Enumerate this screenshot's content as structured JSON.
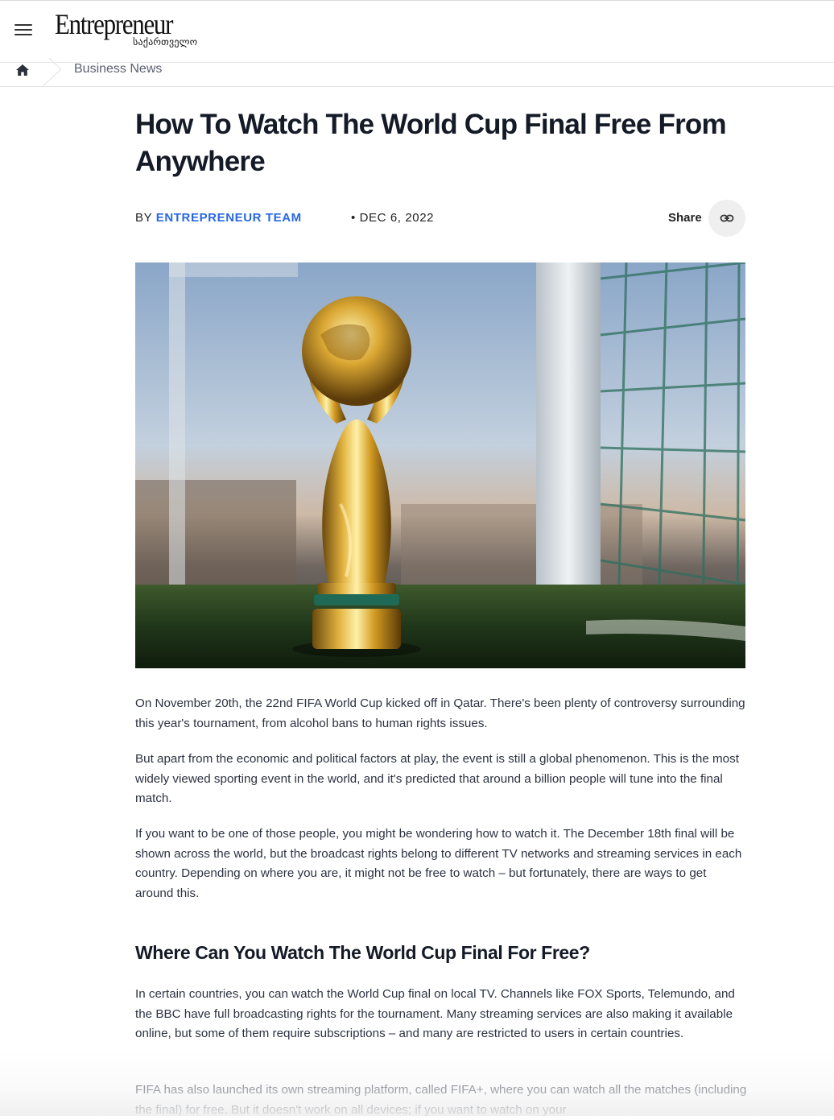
{
  "header": {
    "logo_main": "Entrepreneur",
    "logo_sub": "საქართველო"
  },
  "breadcrumb": {
    "section": "Business News"
  },
  "article": {
    "title": "How To Watch The World Cup Final Free From Anywhere",
    "by_prefix": "BY",
    "author": "ENTREPRENEUR TEAM",
    "date": "• DEC 6, 2022",
    "share_label": "Share",
    "paragraphs": [
      "On November 20th, the 22nd FIFA World Cup kicked off in Qatar. There's been plenty of controversy surrounding this year's tournament, from alcohol bans to human rights issues.",
      "But apart from the economic and political factors at play, the event is still a global phenomenon. This is the most widely viewed sporting event in the world, and it's predicted that around a billion people will tune into the final match.",
      "If you want to be one of those people, you might be wondering how to watch it. The December 18th final will be shown across the world, but the broadcast rights belong to different TV networks and streaming services in each country. Depending on where you are, it might not be free to watch – but fortunately, there are ways to get around this."
    ],
    "section_heading": "Where Can You Watch The World Cup Final For Free?",
    "section_paragraphs": [
      "In certain countries, you can watch the World Cup final on local TV. Channels like FOX Sports, Telemundo, and the BBC have full broadcasting rights for the tournament. Many streaming services are also making it available online, but some of them require subscriptions – and many are restricted to users in certain countries.",
      "FIFA has also launched its own streaming platform, called FIFA+, where you can watch all the matches (including the final) for free. But it doesn't work on all devices; if you want to watch on your"
    ]
  },
  "icons": {
    "menu": "hamburger-menu-icon",
    "home": "home-icon",
    "share": "link-icon"
  },
  "colors": {
    "accent": "#2968e0",
    "title": "#141a26"
  }
}
